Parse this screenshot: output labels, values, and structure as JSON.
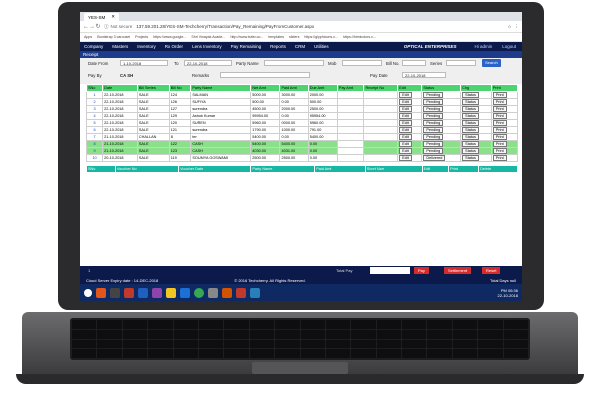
{
  "browser": {
    "tab_title": "YES-SM",
    "nav": {
      "back": "←",
      "forward": "→",
      "reload": "↻"
    },
    "secure_label": "Not secure",
    "url": "137.59.201.28/YES-SM-Techcherry/Transaction/Pay_Remaining/PayFromCustomer.aspx",
    "bookmarks": [
      "Apps",
      "Bootstrap 3 carousel",
      "Projects",
      "https://www.google...",
      "Shri Vinayak Acade...",
      "http://www.tsiter.co...",
      "templates",
      "sliders",
      "https://glyphicons.c...",
      "https://htmlcolors.c..."
    ]
  },
  "app": {
    "menu": [
      "Company",
      "Masters",
      "Inventory",
      "Rx Order",
      "Lens Inventory",
      "Pay Remaining",
      "Reports",
      "CRM",
      "Utilities"
    ],
    "brand": "OPTICAL ENTERPRISES",
    "user": "Hi admin",
    "logout": "Logout",
    "section_title": "Receipt",
    "filters": {
      "date_from_label": "Date From",
      "date_from_value": "1-10-2018",
      "to_label": "To",
      "to_value": "22-10-2018",
      "party_name_label": "Party Name",
      "mob_label": "Mob",
      "bill_no_label": "Bill No.",
      "series_label": "Series",
      "search_label": "Search",
      "pay_by_label": "Pay By",
      "pay_by_value": "CA SH",
      "remarks_label": "Remarks",
      "pay_date_label": "Pay Date",
      "pay_date_value": "22-10-2018"
    },
    "table": {
      "headers": [
        "SNo",
        "Date",
        "Bill Series",
        "Bill No",
        "Party Name",
        "Net Amt",
        "Paid Amt",
        "Due Amt",
        "Pay Amt",
        "Receipt No",
        "Edit",
        "Status",
        "Chg",
        "Print"
      ],
      "rows": [
        [
          "1",
          "22-10-2018",
          "SALE",
          "124",
          "SALMAN",
          "5000.00",
          "3000.00",
          "2000.00",
          "",
          "",
          "Edit",
          "Pending",
          "Status",
          "Print"
        ],
        [
          "2",
          "22-10-2018",
          "SALE",
          "126",
          "SUFIYA",
          "500.00",
          "0.00",
          "500.00",
          "",
          "",
          "Edit",
          "Pending",
          "Status",
          "Print"
        ],
        [
          "3",
          "22-10-2018",
          "SALE",
          "127",
          "surendra",
          "4500.00",
          "2000.00",
          "2500.00",
          "",
          "",
          "Edit",
          "Pending",
          "Status",
          "Print"
        ],
        [
          "4",
          "22-10-2018",
          "SALE",
          "129",
          "Ashok Kumar",
          "95954.00",
          "0.00",
          "95954.00",
          "",
          "",
          "Edit",
          "Pending",
          "Status",
          "Print"
        ],
        [
          "5",
          "22-10-2018",
          "SALE",
          "120",
          "SUREN",
          "5960.00",
          "0000.00",
          "5960.00",
          "",
          "",
          "Edit",
          "Pending",
          "Status",
          "Print"
        ],
        [
          "6",
          "22-10-2018",
          "SALE",
          "121",
          "surendra",
          "1790.00",
          "1000.00",
          "791.00",
          "",
          "",
          "Edit",
          "Pending",
          "Status",
          "Print"
        ],
        [
          "7",
          "21-10-2018",
          "CHALLAN",
          "8",
          "ter",
          "5400.00",
          "0.00",
          "5400.00",
          "",
          "",
          "Edit",
          "Pending",
          "Status",
          "Print"
        ],
        [
          "8",
          "21-10-2018",
          "SALE",
          "122",
          "CASH",
          "5400.00",
          "5400.00",
          "0.00",
          "",
          "",
          "Edit",
          "Pending",
          "Status",
          "Print"
        ],
        [
          "9",
          "21-10-2018",
          "SALE",
          "123",
          "CASH",
          "4030.00",
          "4031.00",
          "0.00",
          "",
          "",
          "Edit",
          "Pending",
          "Status",
          "Print"
        ],
        [
          "10",
          "20-10-2018",
          "SALE",
          "119",
          "SOUMYA GOSWAMI",
          "2500.00",
          "2500.00",
          "0.00",
          "",
          "",
          "Edit",
          "Delivered",
          "Status",
          "Print"
        ]
      ]
    },
    "second_table_headers": [
      "SNo",
      "Voucher No",
      "Voucher Date",
      "Party Name",
      "Paid Amt",
      "Short Narr",
      "Edit",
      "Print",
      "Delete"
    ],
    "bottom": {
      "total_pay_label": "Total Pay",
      "pay_button": "Pay",
      "settlement_button": "Settlement",
      "reset_button": "Reset",
      "page_no": "1"
    },
    "footer": {
      "expiry": "Cloud Server Expiry date : 14-DEC-2018",
      "copyright": "© 2016 Techcherry. All Rights Reserved.",
      "total_days": "Total Days null"
    }
  },
  "taskbar": {
    "time": "PM 06:36",
    "date": "22-10-2018"
  },
  "colors": {
    "nav_bg": "#0b1a4a",
    "header_green": "#4dd36f",
    "row_alt_green": "#8be08a",
    "teal_header": "#17b7a4",
    "pay_red": "#d62b2b"
  }
}
